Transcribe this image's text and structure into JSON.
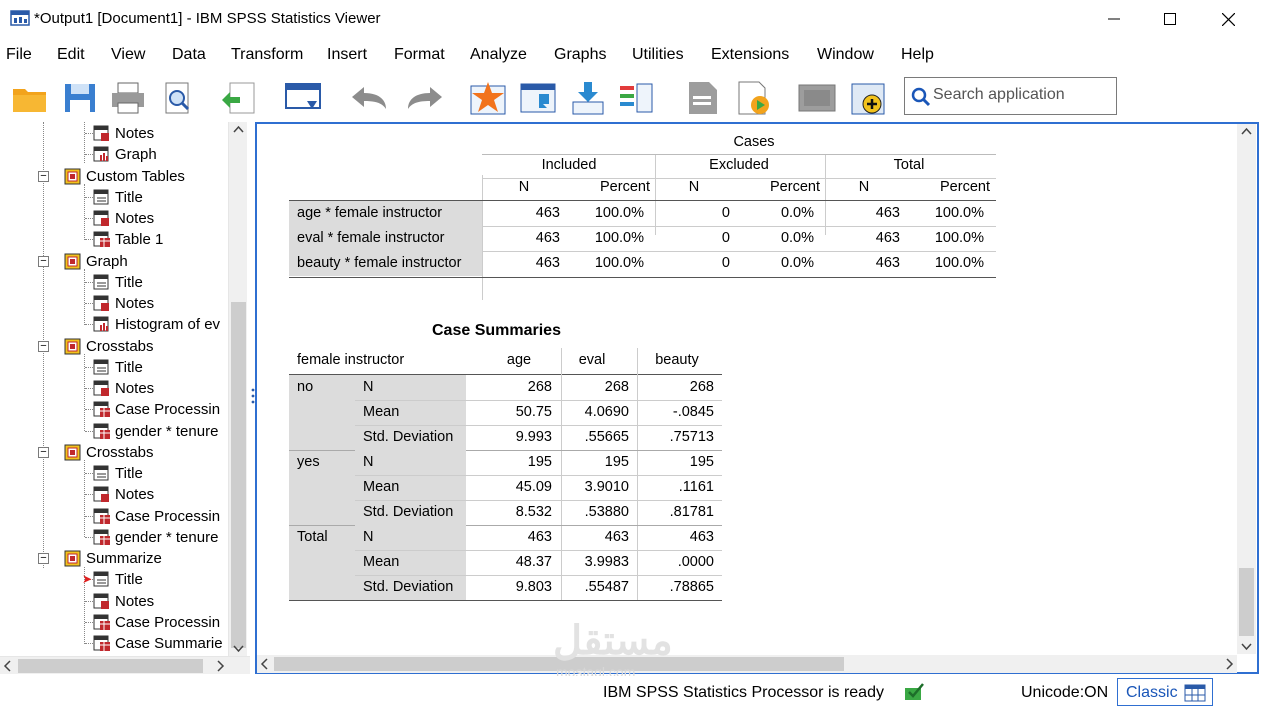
{
  "window": {
    "title": "*Output1 [Document1] - IBM SPSS Statistics Viewer"
  },
  "menu": [
    "File",
    "Edit",
    "View",
    "Data",
    "Transform",
    "Insert",
    "Format",
    "Analyze",
    "Graphs",
    "Utilities",
    "Extensions",
    "Window",
    "Help"
  ],
  "toolbar": {
    "search_placeholder": "Search application",
    "icons": [
      "open-icon",
      "save-icon",
      "print-icon",
      "print-preview-icon",
      "export-icon",
      "recall-dialog-icon",
      "undo-icon",
      "redo-icon",
      "goto-data-icon",
      "goto-case-icon",
      "goto-variable-icon",
      "variables-icon",
      "designate-window-icon",
      "run-script-icon",
      "show-all-icon",
      "insert-output-icon"
    ]
  },
  "outline": {
    "nodes": [
      {
        "label": "Notes",
        "icon": "notes-icon"
      },
      {
        "label": "Graph",
        "icon": "graph-icon"
      },
      {
        "label": "Custom Tables",
        "icon": "folder-icon"
      },
      {
        "label": "Title",
        "icon": "title-icon"
      },
      {
        "label": "Notes",
        "icon": "notes-icon"
      },
      {
        "label": "Table 1",
        "icon": "table-icon"
      },
      {
        "label": "Graph",
        "icon": "folder-icon"
      },
      {
        "label": "Title",
        "icon": "title-icon"
      },
      {
        "label": "Notes",
        "icon": "notes-icon"
      },
      {
        "label": "Histogram of ev",
        "icon": "graph-icon"
      },
      {
        "label": "Crosstabs",
        "icon": "folder-icon"
      },
      {
        "label": "Title",
        "icon": "title-icon"
      },
      {
        "label": "Notes",
        "icon": "notes-icon"
      },
      {
        "label": "Case Processin",
        "icon": "table-icon"
      },
      {
        "label": "gender * tenure",
        "icon": "table-icon"
      },
      {
        "label": "Crosstabs",
        "icon": "folder-icon"
      },
      {
        "label": "Title",
        "icon": "title-icon"
      },
      {
        "label": "Notes",
        "icon": "notes-icon"
      },
      {
        "label": "Case Processin",
        "icon": "table-icon"
      },
      {
        "label": "gender * tenure",
        "icon": "table-icon"
      },
      {
        "label": "Summarize",
        "icon": "folder-icon"
      },
      {
        "label": "Title",
        "icon": "title-icon"
      },
      {
        "label": "Notes",
        "icon": "notes-icon"
      },
      {
        "label": "Case Processin",
        "icon": "table-icon"
      },
      {
        "label": "Case Summarie",
        "icon": "table-icon"
      }
    ]
  },
  "case_processing": {
    "header_cases": "Cases",
    "header_included": "Included",
    "header_excluded": "Excluded",
    "header_total": "Total",
    "col_n": "N",
    "col_percent": "Percent",
    "rows": [
      {
        "label": "age  * female instructor",
        "inc_n": "463",
        "inc_p": "100.0%",
        "exc_n": "0",
        "exc_p": "0.0%",
        "tot_n": "463",
        "tot_p": "100.0%"
      },
      {
        "label": "eval  * female instructor",
        "inc_n": "463",
        "inc_p": "100.0%",
        "exc_n": "0",
        "exc_p": "0.0%",
        "tot_n": "463",
        "tot_p": "100.0%"
      },
      {
        "label": "beauty  * female instructor",
        "inc_n": "463",
        "inc_p": "100.0%",
        "exc_n": "0",
        "exc_p": "0.0%",
        "tot_n": "463",
        "tot_p": "100.0%"
      }
    ]
  },
  "case_summaries": {
    "title": "Case Summaries",
    "header_group": "female instructor",
    "columns": [
      "age",
      "eval",
      "beauty"
    ],
    "groups": [
      {
        "name": "no",
        "rows": [
          {
            "stat": "N",
            "values": [
              "268",
              "268",
              "268"
            ]
          },
          {
            "stat": "Mean",
            "values": [
              "50.75",
              "4.0690",
              "-.0845"
            ]
          },
          {
            "stat": "Std. Deviation",
            "values": [
              "9.993",
              ".55665",
              ".75713"
            ]
          }
        ]
      },
      {
        "name": "yes",
        "rows": [
          {
            "stat": "N",
            "values": [
              "195",
              "195",
              "195"
            ]
          },
          {
            "stat": "Mean",
            "values": [
              "45.09",
              "3.9010",
              ".1161"
            ]
          },
          {
            "stat": "Std. Deviation",
            "values": [
              "8.532",
              ".53880",
              ".81781"
            ]
          }
        ]
      },
      {
        "name": "Total",
        "rows": [
          {
            "stat": "N",
            "values": [
              "463",
              "463",
              "463"
            ]
          },
          {
            "stat": "Mean",
            "values": [
              "48.37",
              "3.9983",
              ".0000"
            ]
          },
          {
            "stat": "Std. Deviation",
            "values": [
              "9.803",
              ".55487",
              ".78865"
            ]
          }
        ]
      }
    ]
  },
  "status": {
    "processor": "IBM SPSS Statistics Processor is ready",
    "unicode": "Unicode:ON",
    "mode": "Classic"
  },
  "watermark": {
    "main": "مستقل",
    "sub": "mostaql.com"
  }
}
